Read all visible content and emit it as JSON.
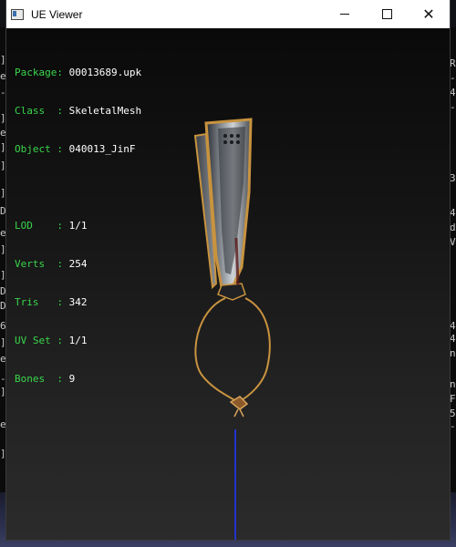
{
  "window": {
    "title": "UE Viewer"
  },
  "titlebar_buttons": {
    "minimize": "minimize",
    "maximize": "maximize",
    "close": "✕"
  },
  "info": {
    "package": {
      "label": "Package: ",
      "value": "00013689.upk"
    },
    "class": {
      "label": "Class  : ",
      "value": "SkeletalMesh"
    },
    "object": {
      "label": "Object : ",
      "value": "040013_JinF"
    },
    "lod": {
      "label": "LOD    : ",
      "value": "1/1"
    },
    "verts": {
      "label": "Verts  : ",
      "value": "254"
    },
    "tris": {
      "label": "Tris   : ",
      "value": "342"
    },
    "uvset": {
      "label": "UV Set : ",
      "value": "1/1"
    },
    "bones": {
      "label": "Bones  : ",
      "value": "9"
    }
  },
  "background_left_glyphs": [
    "]",
    "e",
    "-",
    "]",
    "e",
    "]",
    "]",
    "]",
    "D",
    "e",
    "]",
    "]",
    "D",
    "D",
    "6",
    "]",
    "e",
    "-",
    "]",
    "e",
    "]"
  ],
  "background_right_glyphs": [
    "R",
    "-",
    "4",
    "-",
    "3",
    "4",
    "d",
    "V",
    "4",
    "4",
    "n",
    "n",
    "F",
    "5",
    "-"
  ],
  "colors": {
    "label_green": "#39d64b",
    "value_white": "#ffffff",
    "gold_trim": "#c8933f",
    "blue_axis": "#2233cc"
  }
}
